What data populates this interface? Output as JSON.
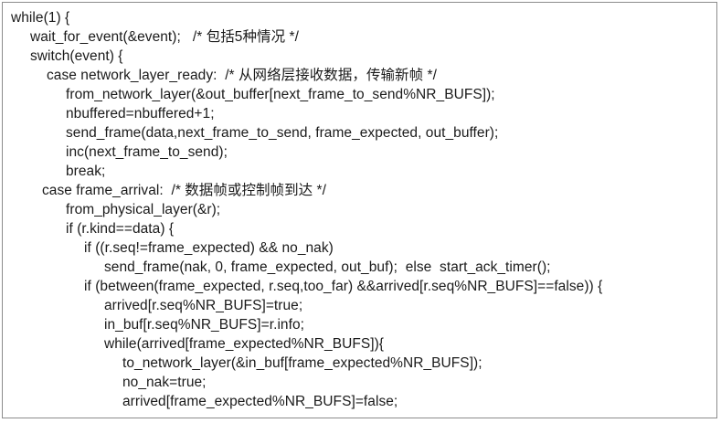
{
  "code_lines": [
    "while(1) {",
    "wait_for_event(&event);   /* 包括5种情况 */",
    "switch(event) {",
    "case network_layer_ready:  /* 从网络层接收数据，传输新帧 */",
    "from_network_layer(&out_buffer[next_frame_to_send%NR_BUFS]);",
    "nbuffered=nbuffered+1;",
    "send_frame(data,next_frame_to_send, frame_expected, out_buffer);",
    "inc(next_frame_to_send);",
    "break;",
    "case frame_arrival:  /* 数据帧或控制帧到达 */",
    "from_physical_layer(&r);",
    "if (r.kind==data) {",
    "if ((r.seq!=frame_expected) && no_nak)",
    "send_frame(nak, 0, frame_expected, out_buf);  else  start_ack_timer();",
    "if (between(frame_expected, r.seq,too_far) &&arrived[r.seq%NR_BUFS]==false)) {",
    "arrived[r.seq%NR_BUFS]=true;",
    "in_buf[r.seq%NR_BUFS]=r.info;",
    "while(arrived[frame_expected%NR_BUFS]){",
    "to_network_layer(&in_buf[frame_expected%NR_BUFS]);",
    "no_nak=true;",
    "arrived[frame_expected%NR_BUFS]=false;"
  ]
}
